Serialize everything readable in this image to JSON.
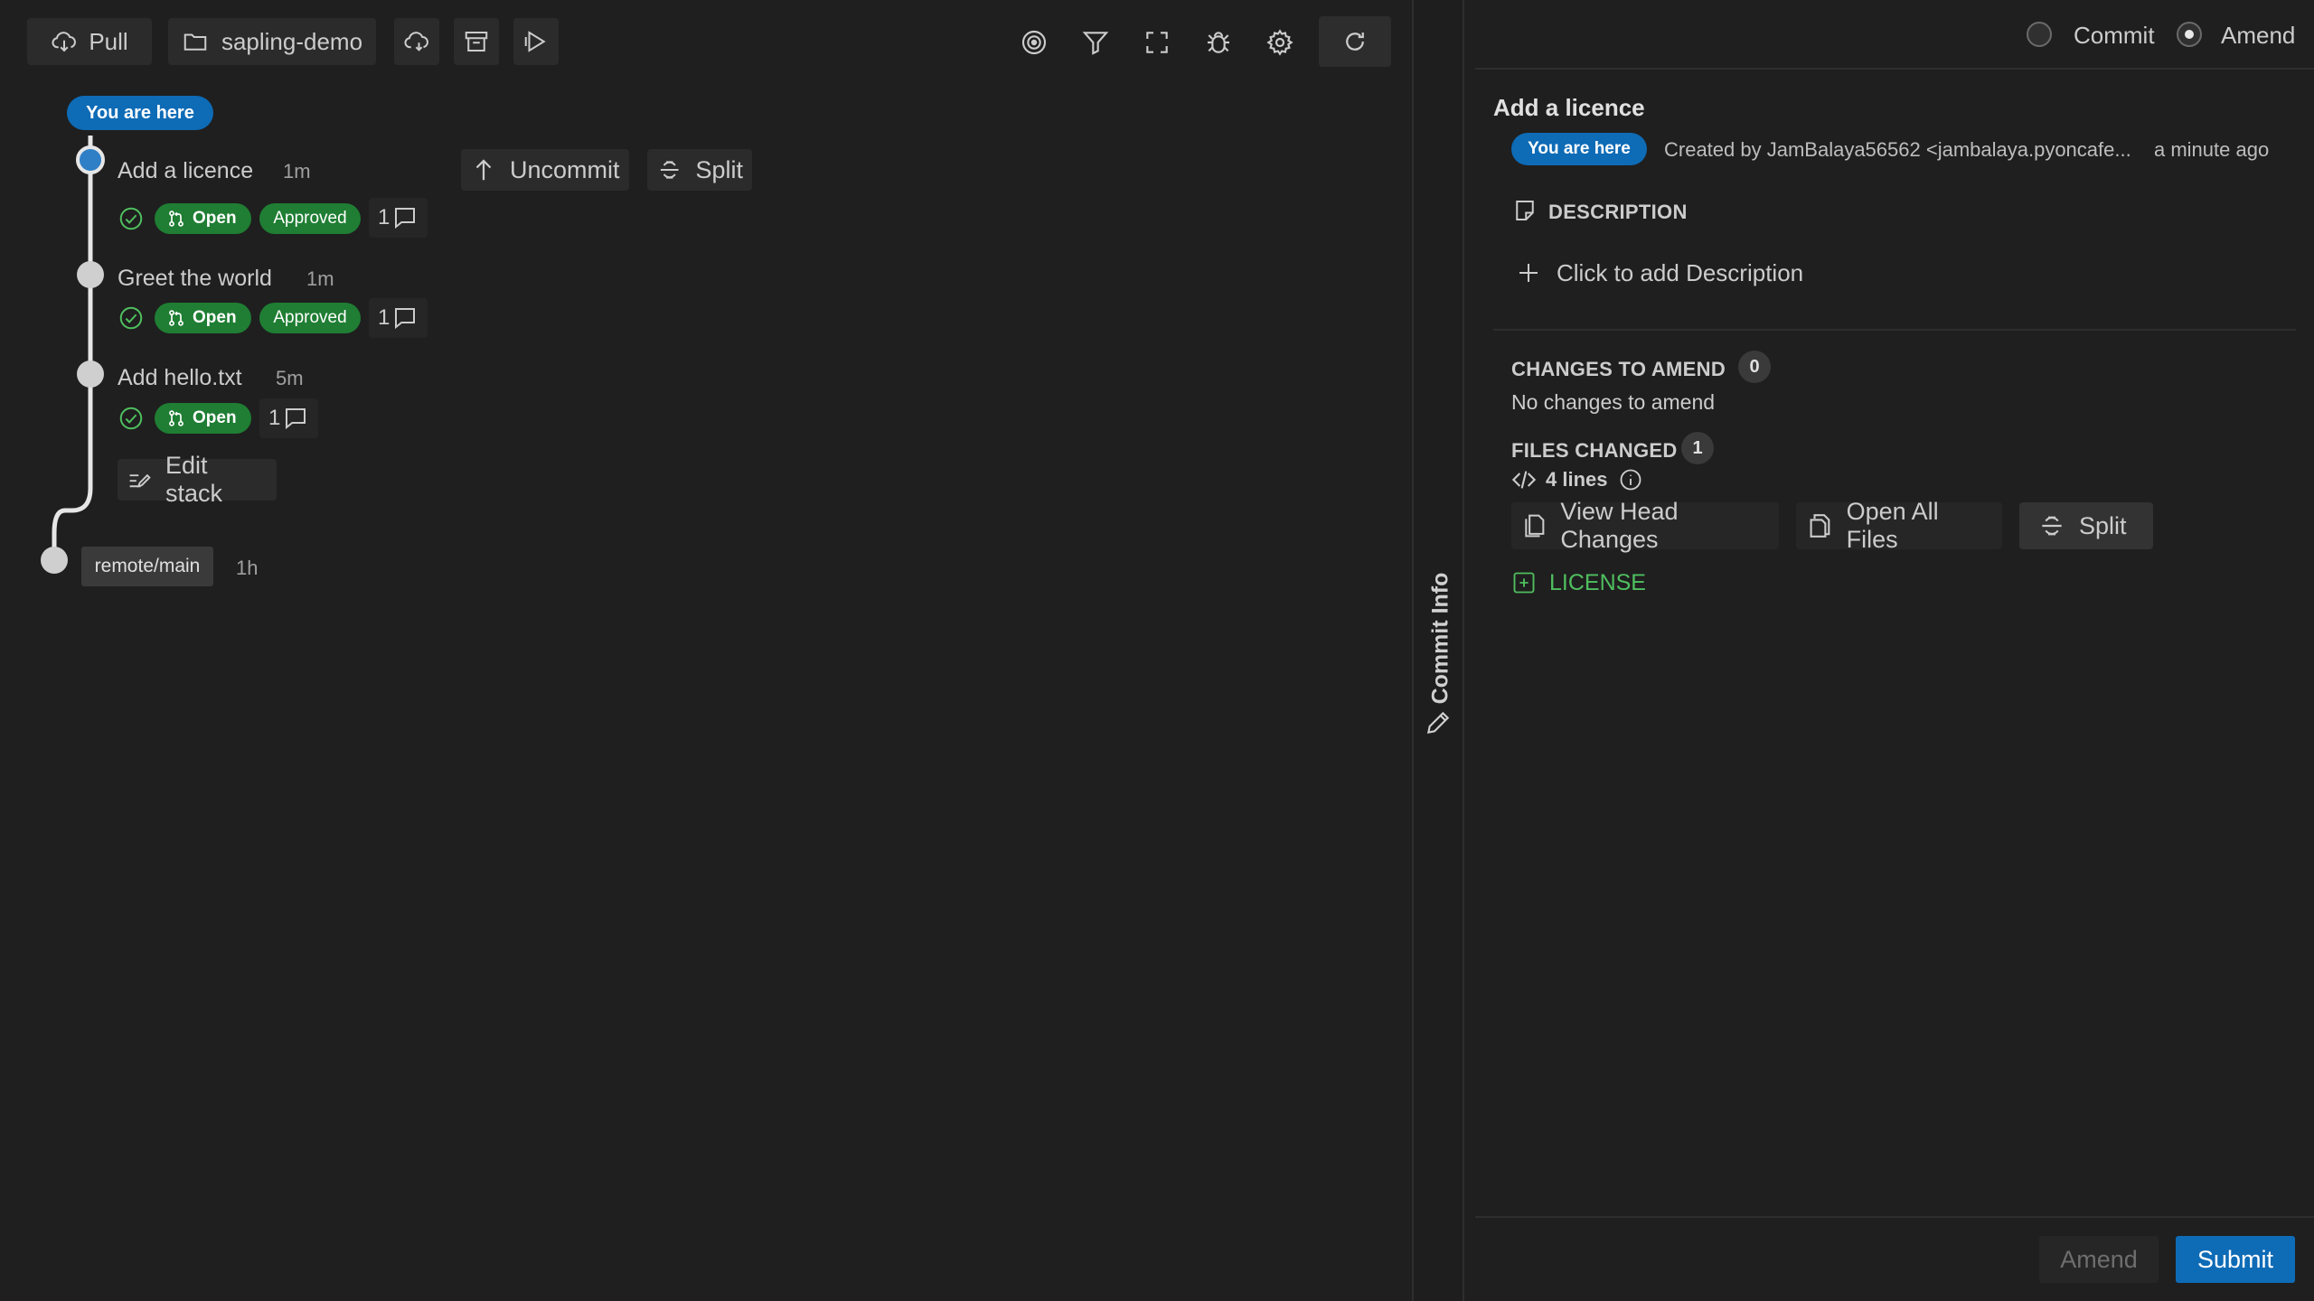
{
  "toolbar": {
    "pull_label": "Pull",
    "repo_label": "sapling-demo",
    "icons": [
      "cloud-download-icon",
      "archive-icon",
      "play-icon",
      "target-icon",
      "filter-icon",
      "fullscreen-icon",
      "bug-icon",
      "gear-icon",
      "refresh-icon"
    ]
  },
  "dag": {
    "you_are_here": "You are here",
    "commits": [
      {
        "title": "Add a licence",
        "time": "1m",
        "status": "Open",
        "review": "Approved",
        "comments": "1"
      },
      {
        "title": "Greet the world",
        "time": "1m",
        "status": "Open",
        "review": "Approved",
        "comments": "1"
      },
      {
        "title": "Add hello.txt",
        "time": "5m",
        "status": "Open",
        "comments": "1"
      }
    ],
    "actions": {
      "uncommit": "Uncommit",
      "split": "Split"
    },
    "edit_stack": "Edit stack",
    "remote": {
      "label": "remote/main",
      "time": "1h"
    }
  },
  "divider_tab": "Commit Info",
  "panel": {
    "mode_commit": "Commit",
    "mode_amend": "Amend",
    "title": "Add a licence",
    "you_are_here": "You are here",
    "created_by": "Created by JamBalaya56562 <jambalaya.pyoncafe...",
    "created_time": "a minute ago",
    "description_heading": "DESCRIPTION",
    "add_description": "Click to add Description",
    "changes_heading": "CHANGES TO AMEND",
    "changes_count": "0",
    "no_changes": "No changes to amend",
    "files_heading": "FILES CHANGED",
    "files_count": "1",
    "lines": "4 lines",
    "view_head": "View Head Changes",
    "open_all": "Open All Files",
    "split": "Split",
    "file": "LICENSE",
    "amend_button": "Amend",
    "submit_button": "Submit"
  },
  "colors": {
    "accent": "#0e6bb6",
    "success": "#1f7e33",
    "added": "#4fbf5f",
    "background": "#1f1f1f"
  }
}
